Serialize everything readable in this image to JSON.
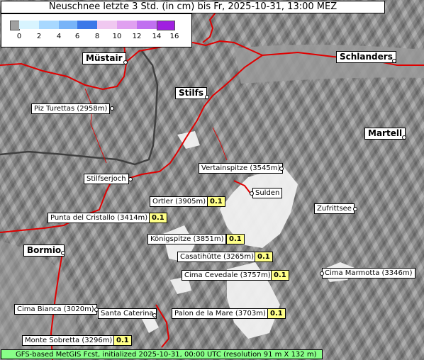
{
  "title": "Neuschnee letzte 3 Std. (in cm) bis Fr, 2025-10-31, 13:00 MEZ",
  "legend": {
    "ticks": [
      "0",
      "2",
      "4",
      "6",
      "8",
      "10",
      "12",
      "14",
      "16"
    ],
    "colors": [
      "#a0a0a0",
      "#d8f4ff",
      "#a8d8ff",
      "#78b4f8",
      "#3c78e8",
      "#f0c8f0",
      "#e0a0f0",
      "#c070f0",
      "#a020e0"
    ]
  },
  "places": {
    "mustair": "Müstair",
    "schlanders": "Schlanders",
    "stilfs": "Stilfs",
    "martell": "Martell",
    "piz_turettas": "Piz Turettas (2958m)",
    "stilfserjoch": "Stilfserjoch",
    "vertainspitze": "Vertainspitze (3545m)",
    "sulden": "Sulden",
    "ortler": "Ortler (3905m)",
    "zufrittsee": "Zufrittsee",
    "punta_cristallo": "Punta del Cristallo (3414m)",
    "konigspitze": "Königspitze (3851m)",
    "bormio": "Bormio",
    "casatihutte": "Casatihütte (3265m)",
    "cima_cevedale": "Cima Cevedale (3757m)",
    "cima_marmotta": "Cima Marmotta (3346m)",
    "cima_bianca": "Cima Bianca (3020m)",
    "santa_caterina": "Santa Caterina",
    "palon_mare": "Palon de la Mare (3703m)",
    "monte_sobretta": "Monte Sobretta (3296m)"
  },
  "values": {
    "ortler": "0.1",
    "punta_cristallo": "0.1",
    "konigspitze": "0.1",
    "casatihutte": "0.1",
    "cima_cevedale": "0.1",
    "palon_mare": "0.1",
    "monte_sobretta": "0.1"
  },
  "footer": "GFS-based MetGIS Fcst, initialized 2025-10-31, 00:00 UTC  (resolution 91 m X 132 m)"
}
